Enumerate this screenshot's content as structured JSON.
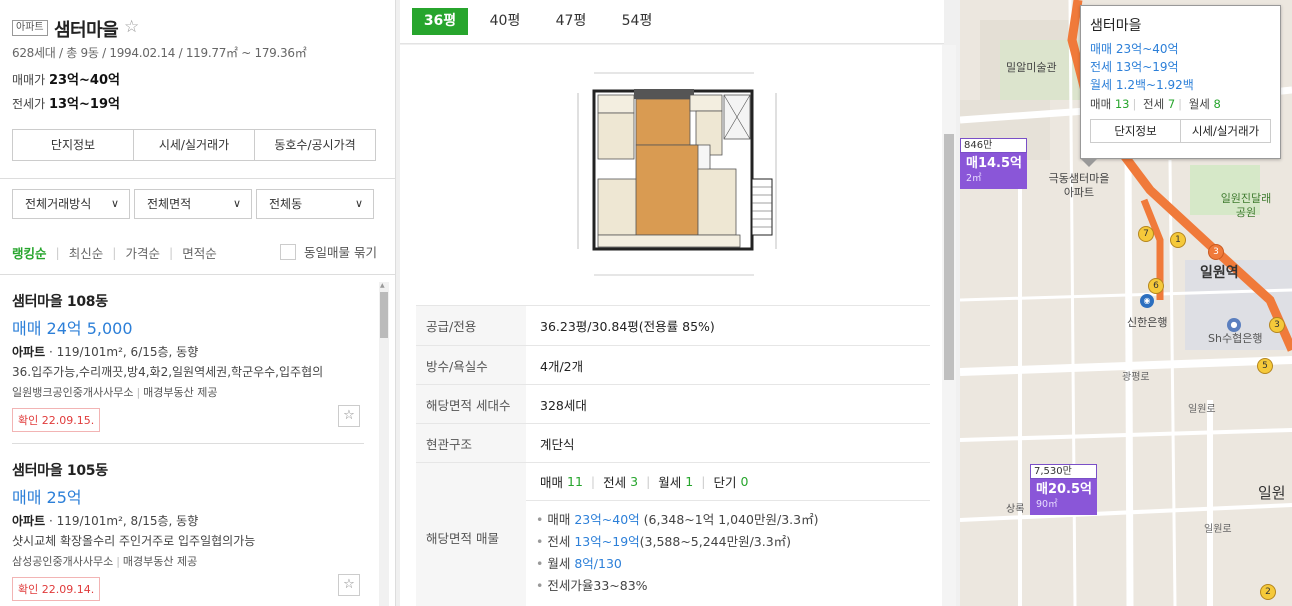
{
  "complex": {
    "badge": "아파트",
    "name": "샘터마을",
    "info": "628세대 / 총 9동 / 1994.02.14 / 119.77㎡ ~ 179.36㎡",
    "sale_label": "매매가",
    "sale_value": "23억~40억",
    "jeonse_label": "전세가",
    "jeonse_value": "13억~19억",
    "buttons": [
      "단지정보",
      "시세/실거래가",
      "동호수/공시가격"
    ]
  },
  "filters": [
    "전체거래방식",
    "전체면적",
    "전체동"
  ],
  "sort": {
    "options": [
      "랭킹순",
      "최신순",
      "가격순",
      "면적순"
    ],
    "active": "랭킹순",
    "bundle_label": "동일매물 묶기"
  },
  "listings": [
    {
      "title": "샘터마을 108동",
      "price": "매매 24억 5,000",
      "type": "아파트",
      "spec": "119/101m², 6/15층, 동향",
      "desc": "36.입주가능,수리깨끗,방4,화2,일원역세권,학군우수,입주협의",
      "agent": "일원뱅크공인중개사사무소",
      "provider": "매경부동산 제공",
      "confirmed": "확인 22.09.15."
    },
    {
      "title": "샘터마을 105동",
      "price": "매매 25억",
      "type": "아파트",
      "spec": "119/101m², 8/15층, 동향",
      "desc": "샷시교체 확장올수리 주인거주로 입주일협의가능",
      "agent": "삼성공인중개사사무소",
      "provider": "매경부동산 제공",
      "confirmed": "확인 22.09.14."
    }
  ],
  "area_tabs": [
    "36평",
    "40평",
    "47평",
    "54평"
  ],
  "active_tab": "36평",
  "details": {
    "supply_label": "공급/전용",
    "supply_value": "36.23평/30.84평(전용률 85%)",
    "rooms_label": "방수/욕실수",
    "rooms_value": "4개/2개",
    "units_label": "해당면적 세대수",
    "units_value": "328세대",
    "entrance_label": "현관구조",
    "entrance_value": "계단식",
    "listings_label": "해당면적 매물",
    "counts": [
      {
        "label": "매매",
        "value": "11"
      },
      {
        "label": "전세",
        "value": "3"
      },
      {
        "label": "월세",
        "value": "1"
      },
      {
        "label": "단기",
        "value": "0"
      }
    ],
    "price_rows": [
      {
        "label": "매매",
        "value": "23억~40억",
        "extra": "(6,348~1억 1,040만원/3.3㎡)"
      },
      {
        "label": "전세",
        "value": "13억~19억",
        "extra": "(3,588~5,244만원/3.3㎡)"
      },
      {
        "label": "월세",
        "value": "8억/130",
        "extra": ""
      },
      {
        "label": "전세가율",
        "value": "",
        "extra": "33~83%"
      }
    ]
  },
  "map": {
    "popup": {
      "title": "샘터마을",
      "sale": "매매 23억~40억",
      "jeonse": "전세 13억~19억",
      "monthly": "월세 1.2백~1.92백",
      "counts": [
        {
          "label": "매매",
          "value": "13"
        },
        {
          "label": "전세",
          "value": "7"
        },
        {
          "label": "월세",
          "value": "8"
        }
      ],
      "buttons": [
        "단지정보",
        "시세/실거래가"
      ]
    },
    "marker1": {
      "tag": "846만",
      "price": "매14.5억",
      "area": "2㎡"
    },
    "marker2": {
      "tag": "7,530만",
      "price": "매20.5억",
      "area": "90㎡"
    },
    "labels": [
      "밀알미술관",
      "극동샘터마을 아파트",
      "일원진달래 공원",
      "일원역",
      "신한은행",
      "Sh수협은행",
      "광평로",
      "일원로",
      "일원",
      "상록",
      "일원로"
    ],
    "exits": [
      "7",
      "1",
      "3",
      "6",
      "3",
      "5",
      "2"
    ]
  },
  "colors": {
    "accent": "#27a52d",
    "price_blue": "#2c7fd8",
    "marker_purple": "#8a56d8",
    "metro_orange": "#f07a3a"
  }
}
